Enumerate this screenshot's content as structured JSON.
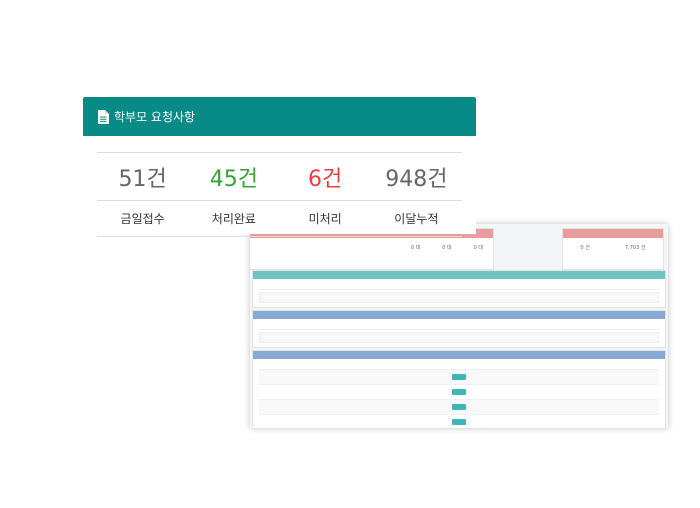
{
  "card": {
    "title": "학부모 요청사항",
    "icon": "document-icon",
    "header_color": "#088b86",
    "stats": [
      {
        "value": "51건",
        "label": "금일접수",
        "color": "#666666"
      },
      {
        "value": "45건",
        "label": "처리완료",
        "color": "#34a33a"
      },
      {
        "value": "6건",
        "label": "미처리",
        "color": "#e84040"
      },
      {
        "value": "948건",
        "label": "이달누적",
        "color": "#666666"
      }
    ]
  },
  "background": {
    "top_left_values": [
      "0 대",
      "0 대",
      "0 대"
    ],
    "top_right_values": [
      "0 건",
      "7,703 건"
    ],
    "panel_colors": [
      "#6fc2bd",
      "#86a9d4",
      "#86a9d4"
    ]
  }
}
